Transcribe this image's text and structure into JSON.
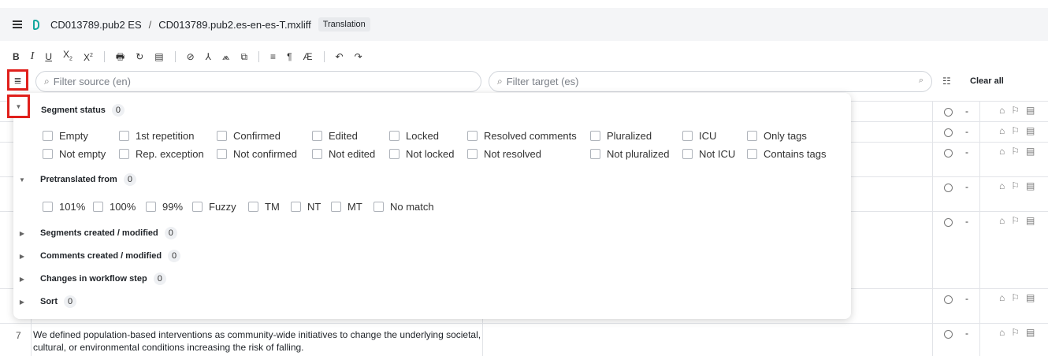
{
  "header": {
    "project": "CD013789.pub2 ES",
    "separator": "/",
    "file": "CD013789.pub2.es-en-es-T.mxliff",
    "step_badge": "Translation"
  },
  "toolbar": {
    "bold": "B",
    "italic": "I",
    "underline": "U",
    "subscript": "X",
    "superscript": "X",
    "icons": [
      "spellcheck-icon",
      "wrap-icon",
      "comment-icon",
      "check-icon",
      "split-icon",
      "join-icon",
      "copy-icon",
      "search-replace-icon",
      "pilcrow-icon",
      "lowercase-icon",
      "undo-icon",
      "redo-icon"
    ]
  },
  "filters": {
    "source_placeholder": "Filter source (en)",
    "target_placeholder": "Filter target (es)",
    "clear_all": "Clear all"
  },
  "popover": {
    "segment_status": {
      "title": "Segment status",
      "count": "0",
      "row1": [
        "Empty",
        "1st repetition",
        "Confirmed",
        "Edited",
        "Locked",
        "Resolved comments",
        "Pluralized",
        "ICU",
        "Only tags"
      ],
      "row2": [
        "Not empty",
        "Rep. exception",
        "Not confirmed",
        "Not edited",
        "Not locked",
        "Not resolved",
        "Not pluralized",
        "Not ICU",
        "Contains tags"
      ]
    },
    "pretranslated": {
      "title": "Pretranslated from",
      "count": "0",
      "options": [
        "101%",
        "100%",
        "99%",
        "Fuzzy",
        "TM",
        "NT",
        "MT",
        "No match"
      ]
    },
    "segments_created": {
      "title": "Segments created / modified",
      "count": "0"
    },
    "comments_created": {
      "title": "Comments created / modified",
      "count": "0"
    },
    "workflow": {
      "title": "Changes in workflow step",
      "count": "0"
    },
    "sort": {
      "title": "Sort",
      "count": "0"
    }
  },
  "rows": [
    {
      "num": "",
      "dash": "-"
    },
    {
      "num": "",
      "dash": "-"
    },
    {
      "num": "",
      "dash": "-"
    },
    {
      "num": "",
      "dash": "-"
    },
    {
      "num": "",
      "dash": "-"
    },
    {
      "num": "",
      "dash": "-"
    },
    {
      "num": "7",
      "dash": "-",
      "source": "We defined population-based interventions as community-wide initiatives to change the underlying societal, cultural, or environmental conditions increasing the risk of falling."
    }
  ],
  "colors": {
    "highlight": "#e0201c",
    "logo": "#13a89e",
    "titlebar_bg": "#f4f5f7"
  }
}
